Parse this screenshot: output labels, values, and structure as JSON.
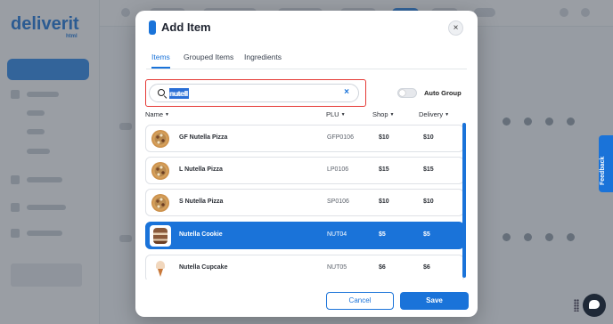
{
  "background": {
    "logo": "deliverit",
    "logo_sub": "html",
    "feedback_label": "Feedback"
  },
  "modal": {
    "title": "Add Item",
    "close_label": "×",
    "tabs": [
      {
        "label": "Items",
        "active": true
      },
      {
        "label": "Grouped Items",
        "active": false
      },
      {
        "label": "Ingredients",
        "active": false
      }
    ],
    "search": {
      "value": "nutell",
      "clear_label": "×"
    },
    "auto_group": {
      "label": "Auto Group",
      "enabled": false
    },
    "columns": {
      "name": "Name",
      "plu": "PLU",
      "shop": "Shop",
      "delivery": "Delivery"
    },
    "items": [
      {
        "name": "GF Nutella Pizza",
        "plu": "GFP0106",
        "shop": "$10",
        "delivery": "$10",
        "icon": "pizza-icon",
        "selected": false
      },
      {
        "name": "L Nutella Pizza",
        "plu": "LP0106",
        "shop": "$15",
        "delivery": "$15",
        "icon": "pizza-icon",
        "selected": false
      },
      {
        "name": "S Nutella Pizza",
        "plu": "SP0106",
        "shop": "$10",
        "delivery": "$10",
        "icon": "pizza-icon",
        "selected": false
      },
      {
        "name": "Nutella Cookie",
        "plu": "NUT04",
        "shop": "$5",
        "delivery": "$5",
        "icon": "cookie-icon",
        "selected": true
      },
      {
        "name": "Nutella Cupcake",
        "plu": "NUT05",
        "shop": "$6",
        "delivery": "$6",
        "icon": "cupcake-icon",
        "selected": false
      }
    ],
    "buttons": {
      "cancel": "Cancel",
      "save": "Save"
    }
  },
  "colors": {
    "accent": "#1a73d9",
    "highlight_border": "#e53935"
  }
}
